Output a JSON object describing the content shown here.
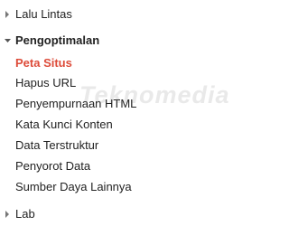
{
  "colors": {
    "active": "#dd4b39",
    "text": "#222222",
    "arrow": "#777777"
  },
  "groups": {
    "lalu_lintas": {
      "label": "Lalu Lintas",
      "icon": "triangle-right-icon"
    },
    "pengoptimalan": {
      "label": "Pengoptimalan",
      "icon": "triangle-down-icon",
      "items": [
        "Peta Situs",
        "Hapus URL",
        "Penyempurnaan HTML",
        "Kata Kunci Konten",
        "Data Terstruktur",
        "Penyorot Data",
        "Sumber Daya Lainnya"
      ],
      "active_item": "Peta Situs"
    },
    "lab": {
      "label": "Lab",
      "icon": "triangle-right-icon"
    }
  },
  "watermark": "Teknomedia"
}
